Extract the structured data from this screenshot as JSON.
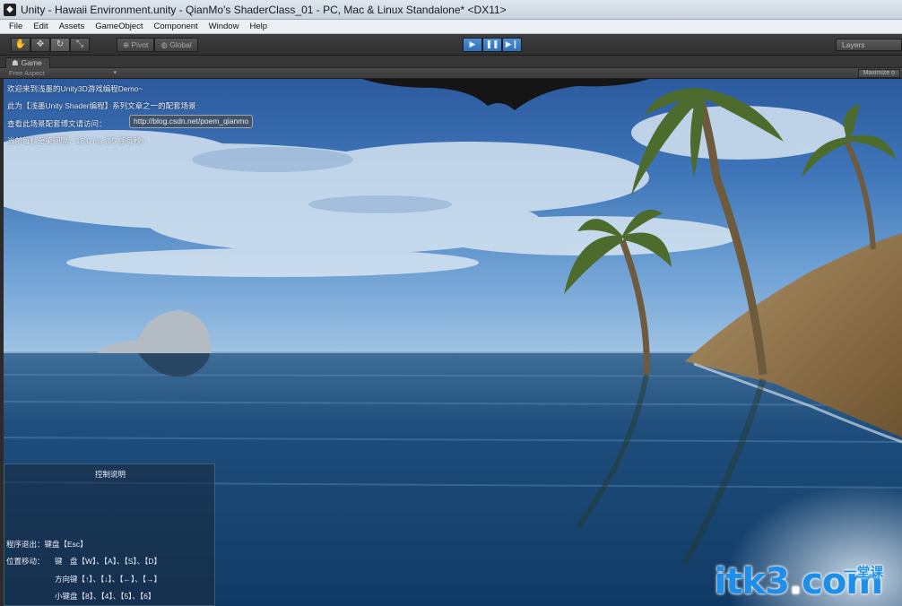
{
  "window": {
    "title": "Unity - Hawaii Environment.unity - QianMo's ShaderClass_01 - PC, Mac & Linux Standalone* <DX11>"
  },
  "menu": [
    "File",
    "Edit",
    "Assets",
    "GameObject",
    "Component",
    "Window",
    "Help"
  ],
  "toolbar": {
    "pivot_label": "Pivot",
    "global_label": "Global",
    "layers_label": "Layers"
  },
  "game": {
    "tab_label": "Game",
    "aspect_label": "Free Aspect",
    "maximize_label": "Maximize o"
  },
  "overlay": {
    "welcome": "欢迎来到浅墨的Unity3D游戏编程Demo~",
    "series": "此为【浅墨Unity Shader编程】系列文章之一的配套场景",
    "visit": "查看此场景配套博文请访问：",
    "link": "http://blog.csdn.net/poem_qianmo",
    "frame": "当前每帧渲染间隔：18.0 ms (55 帧每秒)"
  },
  "controls": {
    "title": "控制说明",
    "exit": "程序退出：键盘【Esc】",
    "move_label": "位置移动：",
    "move_keyboard": "键　盘【W】、【A】、【S】、【D】",
    "move_arrows": "方向键【↑】、【↓】、【←】、【→】",
    "move_numpad": "小键盘【8】、【4】、【5】、【6】"
  },
  "watermark": {
    "text": "itk3",
    "dot": ".",
    "com": "com",
    "cn": "一堂课"
  }
}
